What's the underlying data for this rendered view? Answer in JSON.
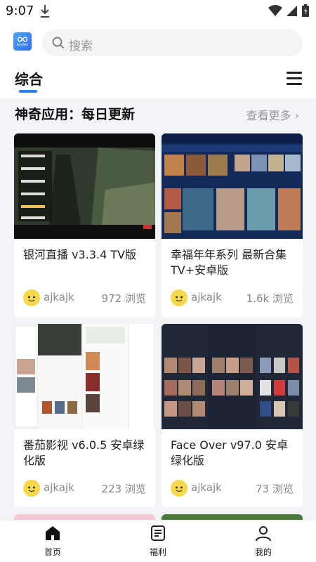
{
  "status_bar": {
    "time": "9:07"
  },
  "header": {
    "logo_text": "Azyleo",
    "search_placeholder": "搜索",
    "active_tab": "综合"
  },
  "section": {
    "title": "神奇应用：每日更新",
    "see_more": "查看更多 ›"
  },
  "cards": [
    {
      "title": "银河直播 v3.3.4 TV版",
      "author": "ajkajk",
      "views": "972 浏览"
    },
    {
      "title": "幸福年年系列 最新合集 TV+安卓版",
      "author": "ajkajk",
      "views": "1.6k 浏览"
    },
    {
      "title": "番茄影视 v6.0.5 安卓绿化版",
      "author": "ajkajk",
      "views": "223 浏览"
    },
    {
      "title": "Face Over v97.0 安卓绿化版",
      "author": "ajkajk",
      "views": "73 浏览"
    }
  ],
  "bottom_nav": [
    {
      "label": "首页",
      "icon": "home-icon"
    },
    {
      "label": "福利",
      "icon": "document-icon"
    },
    {
      "label": "我的",
      "icon": "user-icon"
    }
  ],
  "colors": {
    "accent": "#2f7cf6"
  }
}
